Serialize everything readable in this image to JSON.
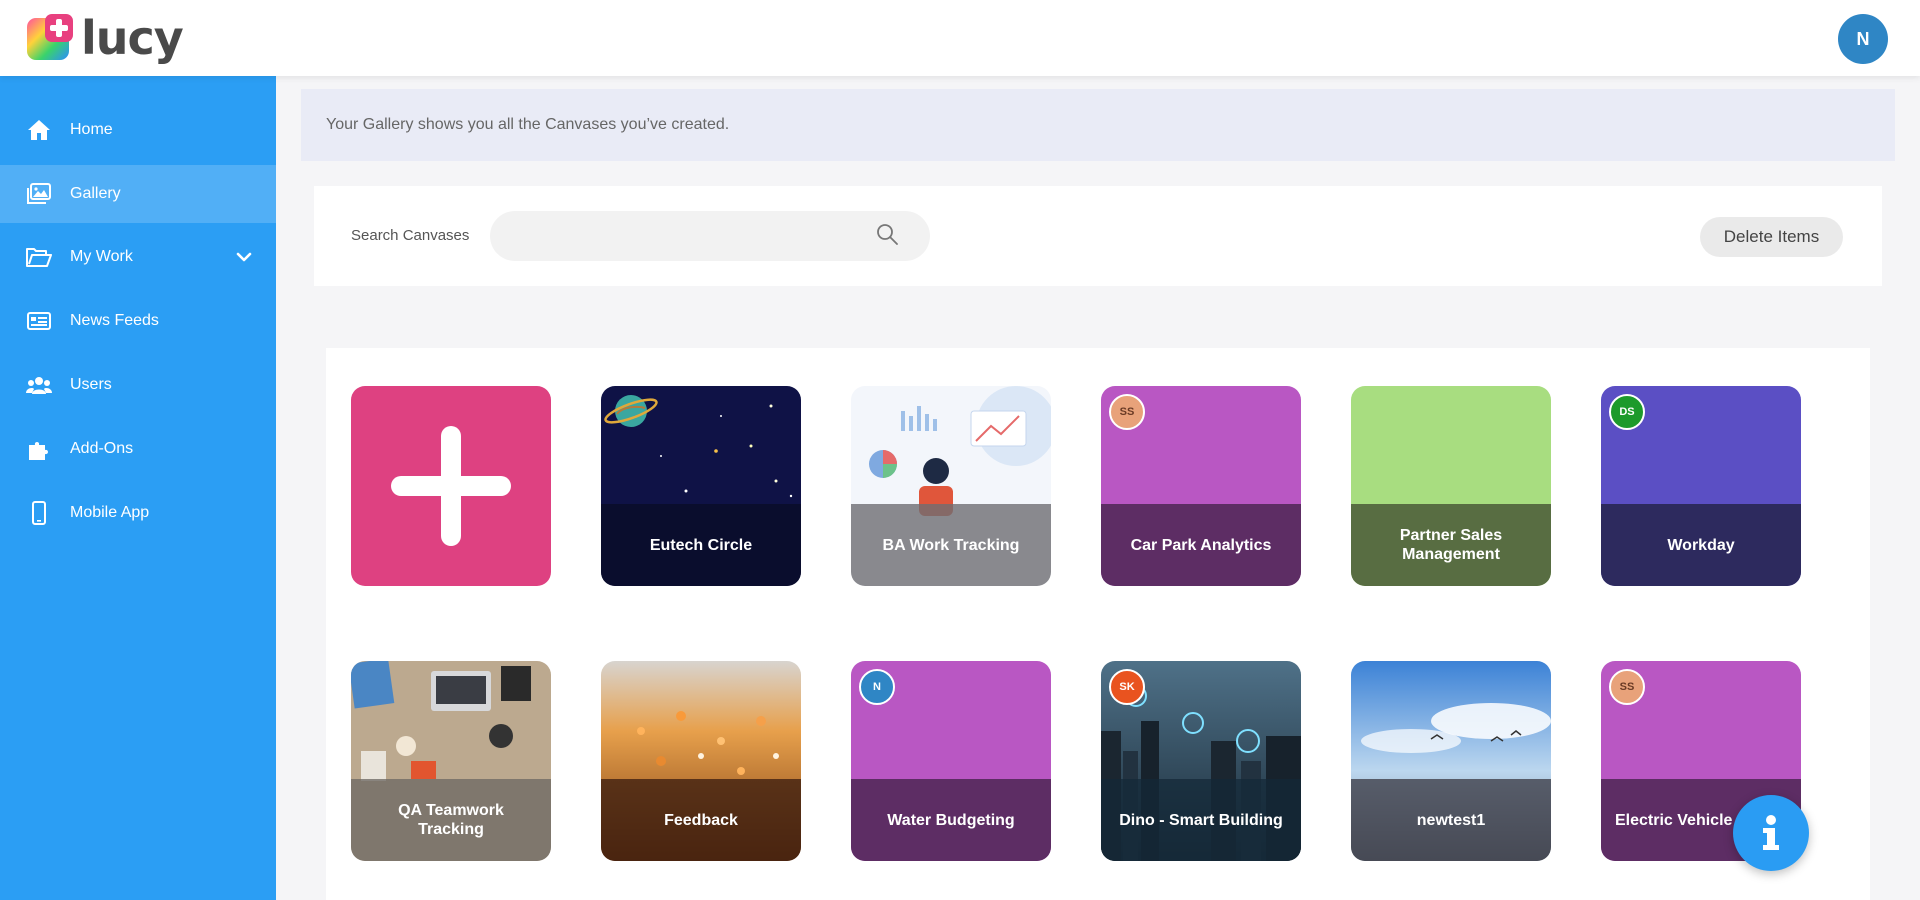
{
  "app": {
    "name": "lucy",
    "accent": "#2b9ef4",
    "user_initial": "N"
  },
  "sidebar": {
    "items": [
      {
        "label": "Home",
        "icon": "home-icon"
      },
      {
        "label": "Gallery",
        "icon": "gallery-icon",
        "active": true
      },
      {
        "label": "My Work",
        "icon": "folder-icon",
        "expandable": true
      },
      {
        "label": "News Feeds",
        "icon": "news-icon"
      },
      {
        "label": "Users",
        "icon": "users-icon"
      },
      {
        "label": "Add-Ons",
        "icon": "puzzle-icon"
      },
      {
        "label": "Mobile App",
        "icon": "mobile-icon"
      }
    ]
  },
  "notice": {
    "text": "Your Gallery shows you all the Canvases you’ve created."
  },
  "search": {
    "label": "Search Canvases",
    "value": "",
    "placeholder": ""
  },
  "toolbar": {
    "delete_label": "Delete Items"
  },
  "gallery": {
    "cards": [
      {
        "title": "Eutech Circle",
        "badge": "",
        "art": "space-image"
      },
      {
        "title": "BA Work Tracking",
        "badge": "",
        "art": "analytics-illustration"
      },
      {
        "title": "Car Park Analytics",
        "badge": "SS",
        "art": "purple"
      },
      {
        "title": "Partner Sales Management",
        "badge": "",
        "art": "green"
      },
      {
        "title": "Workday",
        "badge": "DS",
        "art": "indigo"
      },
      {
        "title": "QA Teamwork Tracking",
        "badge": "",
        "art": "desk-photo"
      },
      {
        "title": "Feedback",
        "badge": "",
        "art": "flowers-photo"
      },
      {
        "title": "Water Budgeting",
        "badge": "N",
        "art": "purple"
      },
      {
        "title": "Dino - Smart Building",
        "badge": "SK",
        "art": "city-photo"
      },
      {
        "title": "newtest1",
        "badge": "",
        "art": "sky-photo"
      },
      {
        "title": "Electric Vehicle Ch",
        "badge": "SS",
        "art": "purple"
      }
    ]
  },
  "info_button": {
    "icon": "info-icon"
  }
}
